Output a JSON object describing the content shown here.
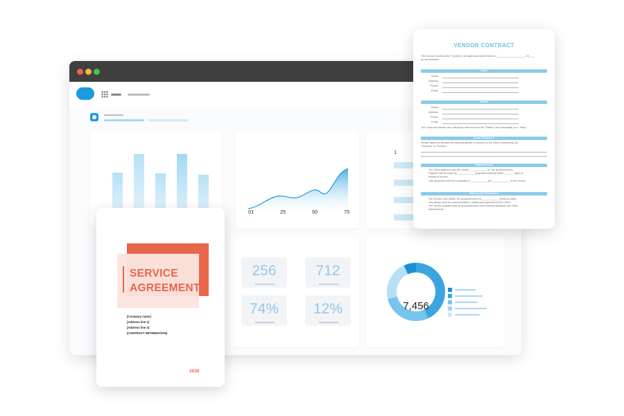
{
  "colors": {
    "brand_blue": "#1b9be0",
    "accent_orange": "#e8664a",
    "accent_blue": "#6dbfe6",
    "window_bar": "#3f3f3f"
  },
  "icons": [
    "cloud-logo",
    "app-grid-icon",
    "record-icon"
  ],
  "dashboard": {
    "line_chart": {
      "type": "area",
      "x_ticks": [
        "01",
        "25",
        "50",
        "75"
      ]
    },
    "right_partial_value": "1",
    "stats": [
      {
        "value": "256"
      },
      {
        "value": "712"
      },
      {
        "value": "74%"
      },
      {
        "value": "12%"
      }
    ],
    "donut": {
      "center_value": "7,456",
      "segments": [
        {
          "value": 0.43,
          "color": "#3aa5df"
        },
        {
          "value": 0.28,
          "color": "#77c4ec"
        },
        {
          "value": 0.22,
          "color": "#b7e0f5"
        },
        {
          "value": 0.07,
          "color": "#1a8fd6"
        }
      ]
    }
  },
  "service_agreement": {
    "title_line1": "SERVICE",
    "title_line2": "AGREEMENT",
    "lines": [
      "[Company name]",
      "[Address line 1]",
      "[Address line 2]",
      "[CONTRACT INFORMATION]"
    ],
    "year": "2026"
  },
  "vendor_contract": {
    "title": "VENDOR CONTRACT",
    "intro_line1": "This Vendor Contract (the \"Contract\") is made and entered into on ____________________, 20____",
    "intro_line2": "by and between:",
    "client_header": "Client",
    "client_fields": [
      "Name:",
      "Address:",
      "Phone:",
      "Email:"
    ],
    "vendor_header": "Vendor",
    "vendor_fields": [
      "Name:",
      "Address:",
      "Phone:",
      "Email:"
    ],
    "parties_note": "The Client and Vendor are collectively referred to as the \"Parties\" and individually as a \"Party.\"",
    "scope_header": "Scope Of Services",
    "scope_line1": "Vendor agrees to provide the following goods or services to the Client (collectively, the",
    "scope_line2": "\"Services\" or \"Goods\"):",
    "payment_header": "Payment Terms",
    "payment_lines": [
      "The Client agrees to pay the vendor ____________ for the goods/services.",
      "Payment will be made by ____________ [payment method] within _______ days of",
      "receipt of invoice.",
      "Late payments will incur a penalty of ____________ per ____________ of the invoice."
    ],
    "delivery_header": "Delivery And Performance",
    "delivery_lines": [
      "The Vendor shall deliver the goods/services by ____________ [Delivery date].",
      "Any delays must be communicated in writing and approved by the Client.",
      "The Vendor warrants that all goods/services meet industry standards and client",
      "requirements."
    ]
  }
}
